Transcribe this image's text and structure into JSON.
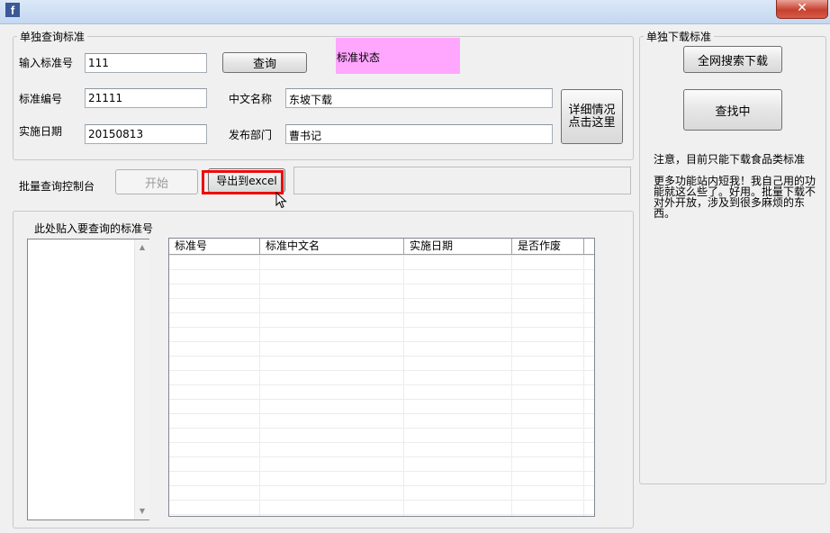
{
  "window": {
    "app_icon": "f",
    "close": "✕"
  },
  "single_query": {
    "group_title": "单独查询标准",
    "input_label": "输入标准号",
    "input_value": "111",
    "query_button": "查询",
    "status_label": "标准状态",
    "std_no_label": "标准编号",
    "std_no_value": "21111",
    "cn_name_label": "中文名称",
    "cn_name_value": "东坡下载",
    "impl_date_label": "实施日期",
    "impl_date_value": "20150813",
    "dept_label": "发布部门",
    "dept_value": "曹书记",
    "detail_button_line1": "详细情况",
    "detail_button_line2": "点击这里"
  },
  "batch": {
    "console_label": "批量查询控制台",
    "start_button": "开始",
    "export_button": "导出到excel",
    "paste_label": "此处贴入要查询的标准号",
    "columns": [
      "标准号",
      "标准中文名",
      "实施日期",
      "是否作废"
    ]
  },
  "single_download": {
    "group_title": "单独下载标准",
    "search_download_button": "全网搜索下载",
    "searching_button": "查找中",
    "note1": "注意，目前只能下载食品类标准",
    "note2": "更多功能站内短我！我自己用的功能就这么些了。好用。批量下载不对外开放，涉及到很多麻烦的东西。"
  },
  "accent_colors": {
    "highlight_border": "#ee0a0a",
    "status_bg": "#ffa6ff"
  }
}
